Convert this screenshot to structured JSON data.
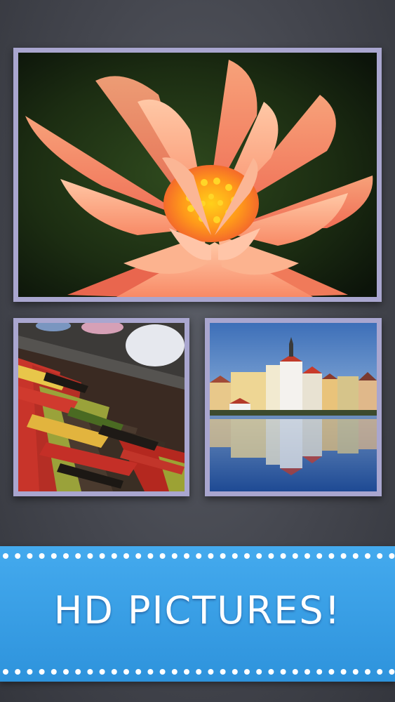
{
  "gallery": {
    "images": [
      {
        "subject": "pink-water-lily-photo"
      },
      {
        "subject": "painted-piano-keys-photo"
      },
      {
        "subject": "lakeside-town-reflection-photo"
      }
    ]
  },
  "banner": {
    "title": "HD PICTURES!",
    "color": "#3aa3e8"
  }
}
